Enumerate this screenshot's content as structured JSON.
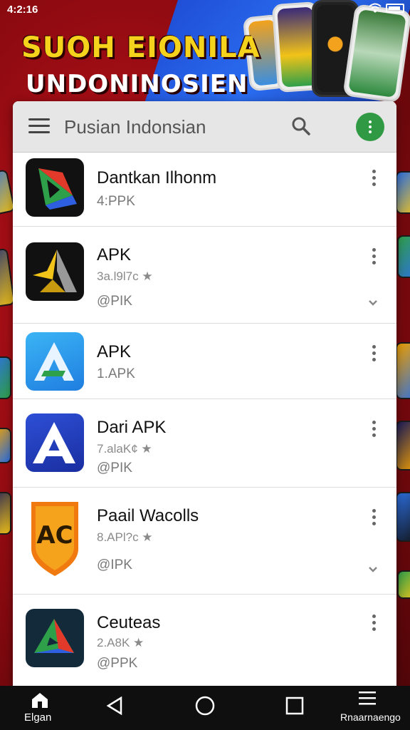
{
  "status_bar": {
    "time": "4:2:16"
  },
  "banner": {
    "title": "SUOH EIONILA",
    "subtitle": "UNDONINOSIEN"
  },
  "app_bar": {
    "title": "Pusian Indonsian"
  },
  "apps": [
    {
      "name": "Dantkan Ilhonm",
      "meta": "",
      "size": "4:PPK",
      "icon": "triangle-logo-icon",
      "expand": false
    },
    {
      "name": "APK",
      "meta": "3a.l9l7c ★",
      "size": "@PIK",
      "icon": "gold-a-logo-icon",
      "expand": true
    },
    {
      "name": "APK",
      "meta": "",
      "size": "1.APK",
      "icon": "blue-a-logo-icon",
      "expand": false
    },
    {
      "name": "Dari APK",
      "meta": "7.alaK¢ ★",
      "size": "@PIK",
      "icon": "a-logo-icon",
      "expand": false
    },
    {
      "name": "Paail Wacolls",
      "meta": "8.APl?c ★",
      "size": "@IPK",
      "icon": "ac-shield-icon",
      "expand": true
    },
    {
      "name": "Ceuteas",
      "meta": "2.A8K ★",
      "size": "@PPK",
      "icon": "prism-logo-icon",
      "expand": false
    }
  ],
  "nav": {
    "home_label": "Elgan",
    "menu_label": "Rnaarnaengo"
  },
  "colors": {
    "accent_green": "#2f9a43",
    "banner_yellow": "#f5d21c",
    "background_red": "#c0121a"
  }
}
